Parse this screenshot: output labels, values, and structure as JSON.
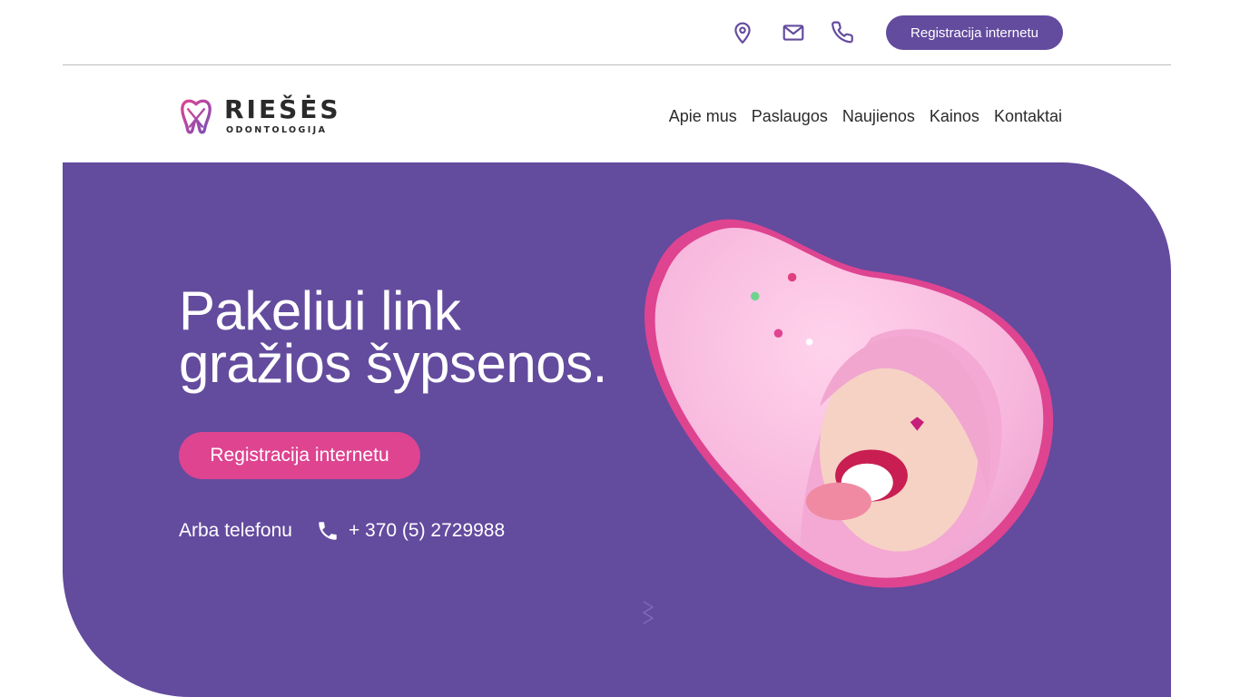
{
  "topbar": {
    "icons": [
      "location-pin-icon",
      "mail-icon",
      "phone-icon"
    ],
    "cta_label": "Registracija internetu"
  },
  "brand": {
    "name": "RIEŠĖS",
    "subtitle": "ODONTOLOGIJA",
    "logo_icon": "tooth-icon"
  },
  "nav": {
    "items": [
      {
        "label": "Apie mus"
      },
      {
        "label": "Paslaugos"
      },
      {
        "label": "Naujienos"
      },
      {
        "label": "Kainos"
      },
      {
        "label": "Kontaktai"
      }
    ]
  },
  "hero": {
    "headline_line1": "Pakeliui link",
    "headline_line2": "gražios šypsenos.",
    "cta_label": "Registracija internetu",
    "alt_label": "Arba telefonu",
    "phone": "+ 370 (5) 2729988"
  },
  "colors": {
    "brand_purple": "#634b9e",
    "accent_pink": "#de4490",
    "text_dark": "#2b2b2b",
    "divider": "#bdbdbd"
  }
}
